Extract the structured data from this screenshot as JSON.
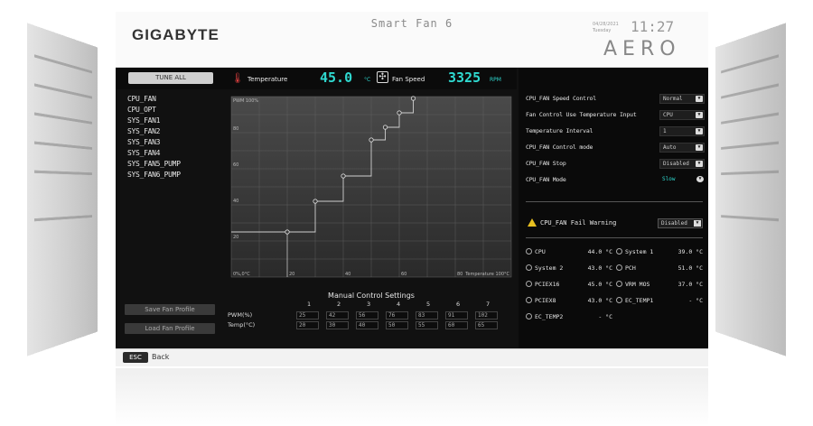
{
  "header": {
    "logo": "GIGABYTE",
    "title": "Smart Fan 6",
    "date": "04/28/2021",
    "day": "Tuesday",
    "time": "11:27",
    "brand": "AERO"
  },
  "topbar": {
    "tune_all": "TUNE ALL",
    "temperature_label": "Temperature",
    "temperature_value": "45.0",
    "temperature_unit": "°C",
    "fan_speed_label": "Fan Speed",
    "fan_speed_value": "3325",
    "fan_speed_unit": "RPM"
  },
  "fans": [
    "CPU_FAN",
    "CPU_OPT",
    "SYS_FAN1",
    "SYS_FAN2",
    "SYS_FAN3",
    "SYS_FAN4",
    "SYS_FAN5_PUMP",
    "SYS_FAN6_PUMP"
  ],
  "buttons": {
    "save": "Save Fan Profile",
    "load": "Load Fan Profile"
  },
  "chart_data": {
    "type": "line",
    "xlabel": "Temperature 100°C",
    "ylabel": "PWM 100%",
    "x_ticks": [
      "0%,0°C",
      "20",
      "40",
      "60",
      "80"
    ],
    "y_ticks": [
      "80",
      "60",
      "40",
      "20"
    ],
    "xlim": [
      0,
      100
    ],
    "ylim": [
      0,
      100
    ],
    "points": [
      [
        20,
        25
      ],
      [
        30,
        42
      ],
      [
        40,
        56
      ],
      [
        50,
        76
      ],
      [
        55,
        83
      ],
      [
        60,
        91
      ],
      [
        65,
        102
      ]
    ],
    "color_line": "#cfcfcf",
    "grid": true
  },
  "manual": {
    "title": "Manual Control Settings",
    "headers": [
      "1",
      "2",
      "3",
      "4",
      "5",
      "6",
      "7"
    ],
    "pwm_label": "PWM(%)",
    "temp_label": "Temp(°C)",
    "pwm": [
      "25",
      "42",
      "56",
      "76",
      "83",
      "91",
      "102"
    ],
    "temp": [
      "20",
      "30",
      "40",
      "50",
      "55",
      "60",
      "65"
    ]
  },
  "settings": [
    {
      "label": "CPU_FAN Speed Control",
      "value": "Normal"
    },
    {
      "label": "Fan Control Use Temperature Input",
      "value": "CPU"
    },
    {
      "label": "Temperature Interval",
      "value": "1"
    },
    {
      "label": "CPU_FAN Control mode",
      "value": "Auto"
    },
    {
      "label": "CPU_FAN Stop",
      "value": "Disabled"
    },
    {
      "label": "CPU_FAN Mode",
      "value": "Slow"
    }
  ],
  "warning": {
    "label": "CPU_FAN Fail Warning",
    "value": "Disabled"
  },
  "sensors": [
    {
      "name": "CPU",
      "value": "44.0 °C"
    },
    {
      "name": "System 1",
      "value": "39.0 °C"
    },
    {
      "name": "System 2",
      "value": "43.0 °C"
    },
    {
      "name": "PCH",
      "value": "51.0 °C"
    },
    {
      "name": "PCIEX16",
      "value": "45.0 °C"
    },
    {
      "name": "VRM MOS",
      "value": "37.0 °C"
    },
    {
      "name": "PCIEX8",
      "value": "43.0 °C"
    },
    {
      "name": "EC_TEMP1",
      "value": "- °C"
    },
    {
      "name": "EC_TEMP2",
      "value": "- °C"
    }
  ],
  "footer": {
    "esc": "ESC",
    "back": "Back"
  },
  "colors": {
    "accent": "#2fd9d0",
    "panel": "#111111",
    "warning": "#e8c020"
  }
}
